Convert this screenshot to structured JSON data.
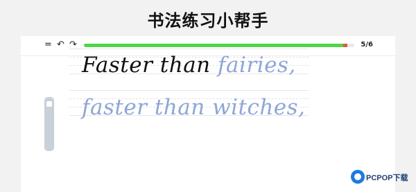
{
  "app": {
    "title": "书法练习小帮手"
  },
  "toolbar": {
    "menu_icon": "menu-icon",
    "undo_icon": "undo-icon",
    "redo_icon": "redo-icon",
    "progress_fraction": 0.96,
    "page_indicator": "5/6"
  },
  "colors": {
    "progress_fill": "#52d44a",
    "progress_marker": "#e25b3a",
    "ink_dark": "#111111",
    "ink_traced": "#8ea6d6"
  },
  "practice": {
    "line1_written": "Faster than ",
    "line1_trace": "fairies,",
    "line2_trace": "faster than witches,"
  },
  "watermark": {
    "text": "PCPOP下载"
  }
}
